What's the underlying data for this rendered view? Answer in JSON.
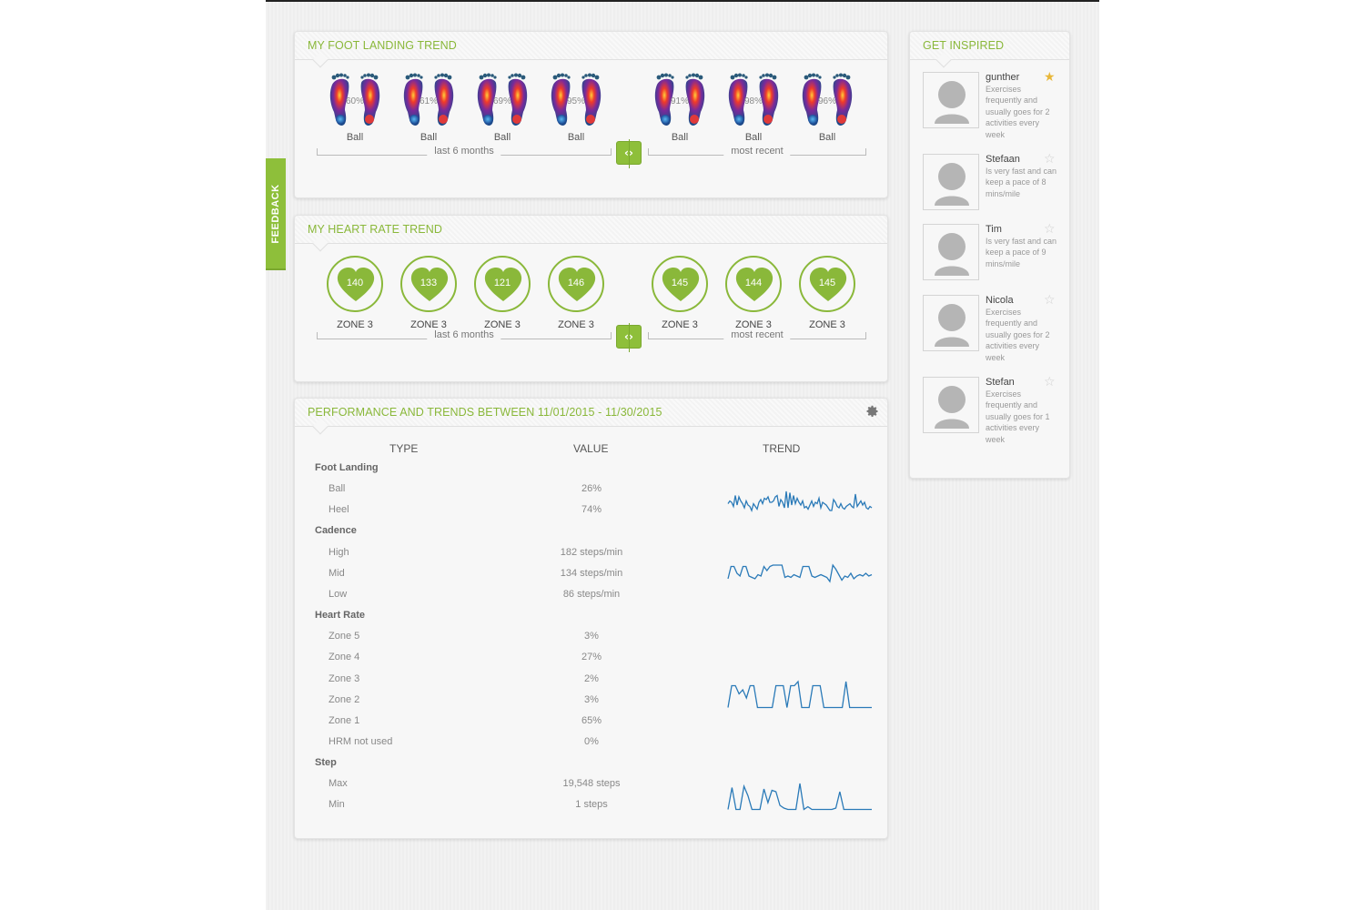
{
  "colors": {
    "accent": "#8ab83a",
    "spark": "#2a7ab8",
    "star_on": "#e8b73a",
    "star_off": "#cfcfcf"
  },
  "feedback": {
    "label": "FEEDBACK"
  },
  "foot_landing": {
    "title": "MY FOOT LANDING TREND",
    "past_range_label": "last 6 months",
    "recent_range_label": "most recent",
    "past": [
      {
        "pct": "60%",
        "label": "Ball"
      },
      {
        "pct": "61%",
        "label": "Ball"
      },
      {
        "pct": "69%",
        "label": "Ball"
      },
      {
        "pct": "95%",
        "label": "Ball"
      }
    ],
    "recent": [
      {
        "pct": "91%",
        "label": "Ball"
      },
      {
        "pct": "98%",
        "label": "Ball"
      },
      {
        "pct": "96%",
        "label": "Ball"
      }
    ],
    "toggle_icon": "left-right-arrows-icon"
  },
  "heart_rate": {
    "title": "MY HEART RATE TREND",
    "past_range_label": "last 6 months",
    "recent_range_label": "most recent",
    "past": [
      {
        "bpm": "140",
        "zone": "ZONE 3"
      },
      {
        "bpm": "133",
        "zone": "ZONE 3"
      },
      {
        "bpm": "121",
        "zone": "ZONE 3"
      },
      {
        "bpm": "146",
        "zone": "ZONE 3"
      }
    ],
    "recent": [
      {
        "bpm": "145",
        "zone": "ZONE 3"
      },
      {
        "bpm": "144",
        "zone": "ZONE 3"
      },
      {
        "bpm": "145",
        "zone": "ZONE 3"
      }
    ]
  },
  "performance": {
    "title": "PERFORMANCE AND TRENDS BETWEEN 11/01/2015 - 11/30/2015",
    "settings_icon": "gear-icon",
    "columns": {
      "type": "TYPE",
      "value": "VALUE",
      "trend": "TREND"
    },
    "groups": [
      {
        "name": "Foot Landing",
        "rows": [
          {
            "label": "Ball",
            "value": "26%"
          },
          {
            "label": "Heel",
            "value": "74%"
          }
        ],
        "trend": [
          0.45,
          0.55,
          0.5,
          0.35,
          0.75,
          0.4,
          0.7,
          0.55,
          0.45,
          0.3,
          0.55,
          0.4,
          0.35,
          0.2,
          0.45,
          0.35,
          0.25,
          0.5,
          0.6,
          0.45,
          0.65,
          0.6,
          0.7,
          0.5,
          0.5,
          0.55,
          0.7,
          0.75,
          0.35,
          0.6,
          0.5,
          0.3,
          0.9,
          0.3,
          0.85,
          0.4,
          0.75,
          0.45,
          0.65,
          0.5,
          0.4,
          0.55,
          0.3,
          0.35,
          0.25,
          0.4,
          0.55,
          0.35,
          0.5,
          0.45,
          0.65,
          0.3,
          0.5,
          0.45,
          0.4,
          0.3,
          0.2,
          0.2,
          0.6,
          0.5,
          0.35,
          0.3,
          0.45,
          0.3,
          0.25,
          0.35,
          0.4,
          0.45,
          0.35,
          0.3,
          0.8,
          0.35,
          0.45,
          0.55,
          0.4,
          0.5,
          0.3,
          0.25,
          0.35,
          0.3
        ]
      },
      {
        "name": "Cadence",
        "rows": [
          {
            "label": "High",
            "value": "182 steps/min"
          },
          {
            "label": "Mid",
            "value": "134 steps/min"
          },
          {
            "label": "Low",
            "value": "86 steps/min"
          }
        ],
        "trend": [
          0.4,
          0.85,
          0.85,
          0.6,
          0.5,
          0.85,
          0.85,
          0.5,
          0.45,
          0.4,
          0.55,
          0.5,
          0.85,
          0.7,
          0.85,
          0.9,
          0.9,
          0.9,
          0.9,
          0.45,
          0.5,
          0.45,
          0.55,
          0.5,
          0.45,
          0.85,
          0.85,
          0.85,
          0.5,
          0.45,
          0.5,
          0.55,
          0.5,
          0.45,
          0.3,
          0.9,
          0.75,
          0.55,
          0.35,
          0.5,
          0.45,
          0.6,
          0.4,
          0.5,
          0.55,
          0.5,
          0.6,
          0.5,
          0.55
        ]
      },
      {
        "name": "Heart Rate",
        "rows": [
          {
            "label": "Zone 5",
            "value": "3%"
          },
          {
            "label": "Zone 4",
            "value": "27%"
          },
          {
            "label": "Zone 3",
            "value": "2%"
          },
          {
            "label": "Zone 2",
            "value": "3%"
          },
          {
            "label": "Zone 1",
            "value": "65%"
          },
          {
            "label": "HRM not used",
            "value": "0%"
          }
        ],
        "trend": [
          0.05,
          0.85,
          0.85,
          0.55,
          0.7,
          0.4,
          0.85,
          0.85,
          0.05,
          0.05,
          0.05,
          0.05,
          0.05,
          0.85,
          0.85,
          0.85,
          0.05,
          0.85,
          0.85,
          1.0,
          0.05,
          0.05,
          0.05,
          0.85,
          0.85,
          0.85,
          0.05,
          0.05,
          0.05,
          0.05,
          0.05,
          0.05,
          1.0,
          0.05,
          0.05,
          0.05,
          0.05,
          0.05,
          0.05,
          0.05
        ]
      },
      {
        "name": "Step",
        "rows": [
          {
            "label": "Max",
            "value": "19,548 steps"
          },
          {
            "label": "Min",
            "value": "1 steps"
          }
        ],
        "trend": [
          0.05,
          0.85,
          0.05,
          0.05,
          0.9,
          0.55,
          0.05,
          0.05,
          0.05,
          0.8,
          0.3,
          0.75,
          0.7,
          0.2,
          0.1,
          0.05,
          0.05,
          0.05,
          1.0,
          0.05,
          0.15,
          0.05,
          0.05,
          0.05,
          0.05,
          0.05,
          0.05,
          0.1,
          0.7,
          0.05,
          0.05,
          0.05,
          0.05,
          0.05,
          0.05,
          0.05,
          0.05
        ]
      }
    ]
  },
  "get_inspired": {
    "title": "GET INSPIRED",
    "people": [
      {
        "name": "gunther",
        "desc": "Exercises frequently and usually goes for 2 activities every week",
        "starred": true
      },
      {
        "name": "Stefaan",
        "desc": "Is very fast and can keep a pace of 8 mins/mile",
        "starred": false
      },
      {
        "name": "Tim",
        "desc": "Is very fast and can keep a pace of 9 mins/mile",
        "starred": false
      },
      {
        "name": "Nicola",
        "desc": "Exercises frequently and usually goes for 2 activities every week",
        "starred": false
      },
      {
        "name": "Stefan",
        "desc": "Exercises frequently and usually goes for 1 activities every week",
        "starred": false
      }
    ]
  }
}
